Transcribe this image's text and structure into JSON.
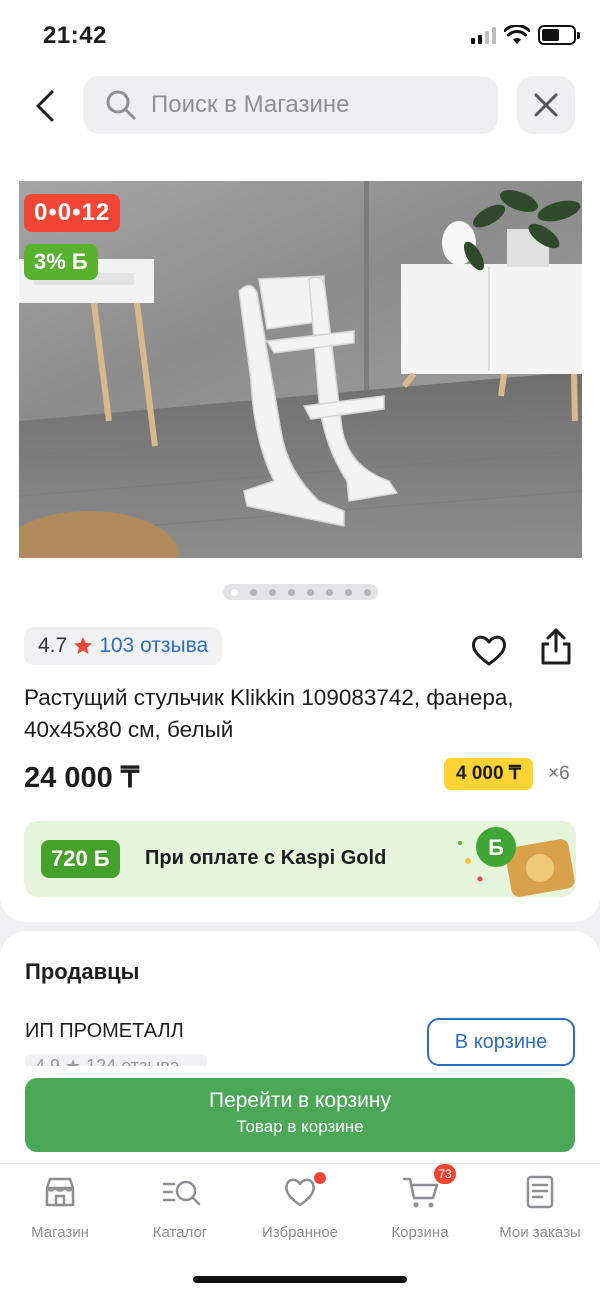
{
  "status_bar": {
    "time": "21:42"
  },
  "search": {
    "placeholder": "Поиск в Магазине"
  },
  "product": {
    "installment_badge": "0•0•12",
    "bonus_badge": "3% Б",
    "image_count": 8,
    "rating": "4.7",
    "reviews": "103 отзыва",
    "title": "Растущий стульчик Klikkin 109083742, фанера, 40x45x80 см, белый",
    "price": "24 000 ₸",
    "installment_price": "4 000 ₸",
    "installment_times": "×6"
  },
  "gold_banner": {
    "bonus": "720 Б",
    "text": "При оплате с Kaspi Gold"
  },
  "sellers": {
    "title": "Продавцы",
    "items": [
      {
        "name": "ИП ПРОМЕТАЛЛ",
        "rating": "4.9 ★ 124 отзыва",
        "button": "В корзине"
      }
    ]
  },
  "cart_cta": {
    "main": "Перейти в корзину",
    "sub": "Товар в корзине"
  },
  "tab_bar": {
    "items": [
      {
        "label": "Магазин",
        "icon": "store-icon"
      },
      {
        "label": "Каталог",
        "icon": "catalog-search-icon"
      },
      {
        "label": "Избранное",
        "icon": "heart-icon"
      },
      {
        "label": "Корзина",
        "icon": "cart-icon",
        "badge": "73"
      },
      {
        "label": "Мои заказы",
        "icon": "orders-icon"
      }
    ]
  },
  "colors": {
    "accent_red": "#f14635",
    "bonus_green": "#58b12f",
    "link_blue": "#2b6fc4",
    "cta_green": "#4aa857",
    "installment_yellow": "#ffd334"
  }
}
